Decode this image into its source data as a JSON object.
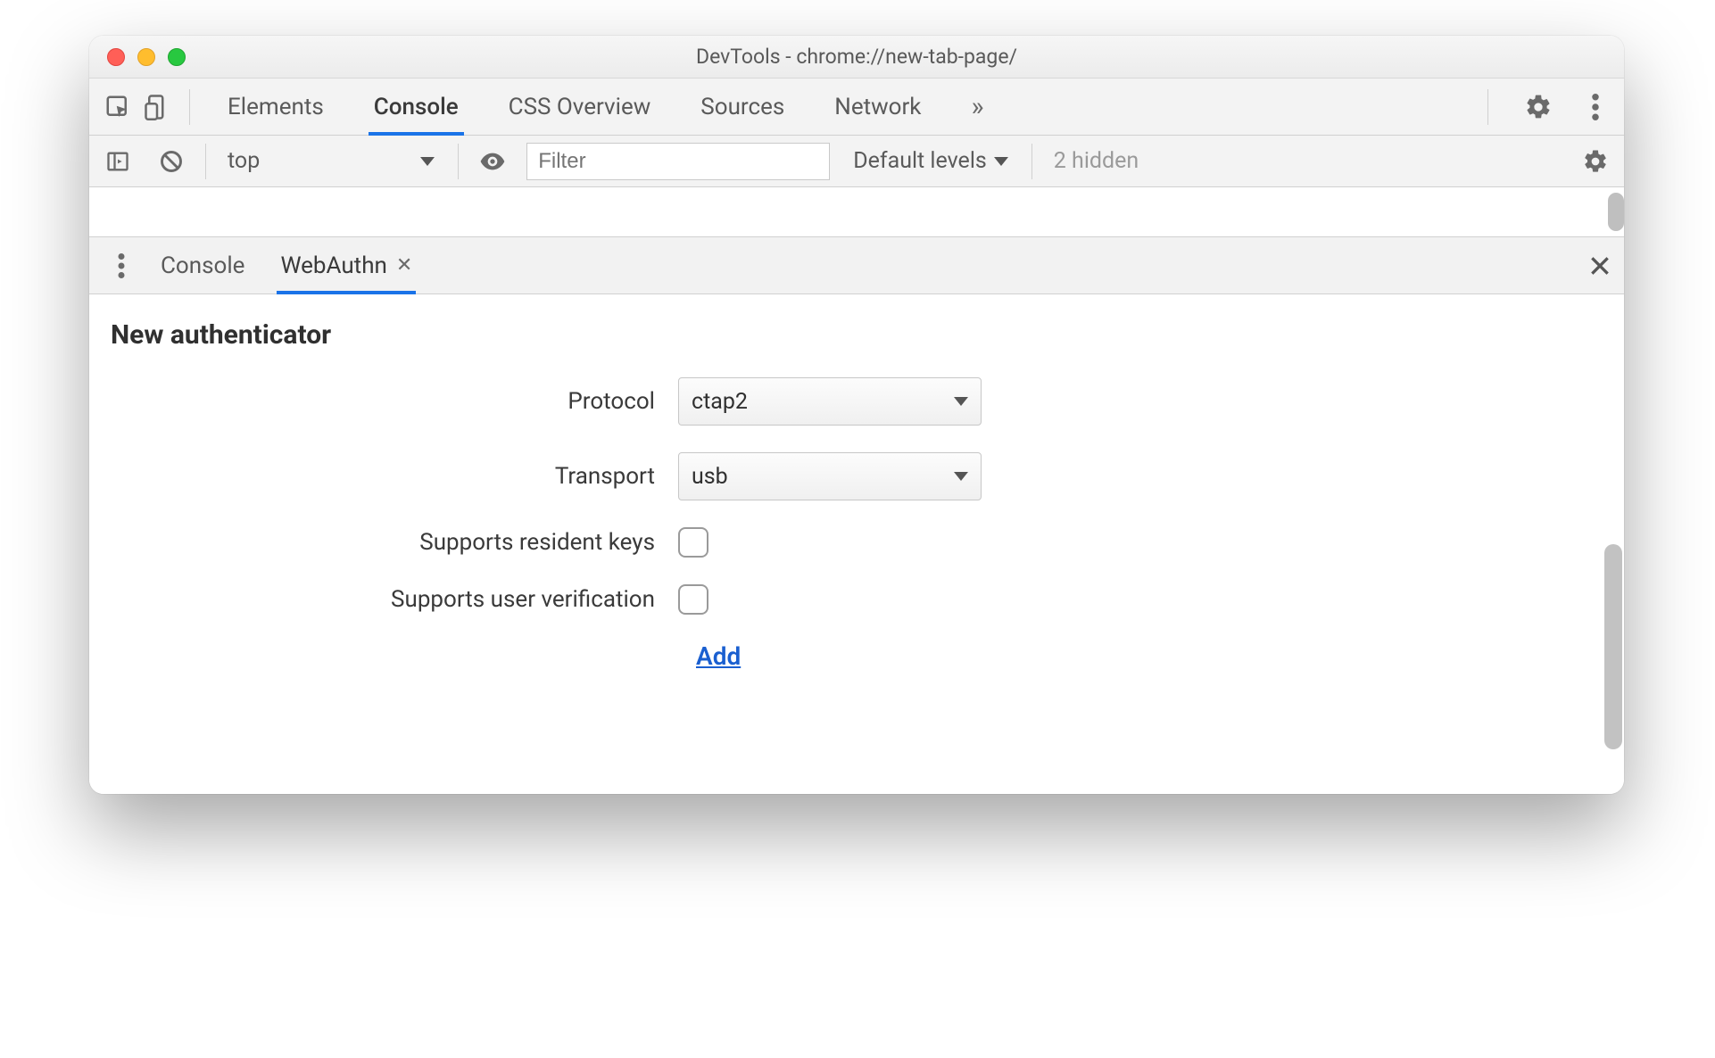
{
  "window": {
    "title": "DevTools - chrome://new-tab-page/"
  },
  "tabs": {
    "elements": "Elements",
    "console": "Console",
    "css_overview": "CSS Overview",
    "sources": "Sources",
    "network": "Network"
  },
  "console_toolbar": {
    "context": "top",
    "filter_placeholder": "Filter",
    "levels": "Default levels",
    "hidden": "2 hidden"
  },
  "drawer": {
    "console_tab": "Console",
    "webauthn_tab": "WebAuthn"
  },
  "webauthn": {
    "heading": "New authenticator",
    "protocol_label": "Protocol",
    "protocol_value": "ctap2",
    "transport_label": "Transport",
    "transport_value": "usb",
    "resident_keys_label": "Supports resident keys",
    "user_verification_label": "Supports user verification",
    "add_label": "Add"
  }
}
